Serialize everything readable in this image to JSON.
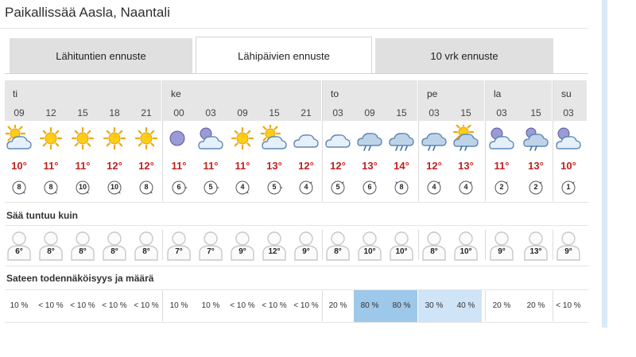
{
  "page": {
    "title": "Paikallissää Aasla, Naantali"
  },
  "tabs": [
    {
      "label": "Lähituntien ennuste",
      "active": false
    },
    {
      "label": "Lähipäivien ennuste",
      "active": true
    },
    {
      "label": "10 vrk ennuste",
      "active": false
    }
  ],
  "days": [
    "ti",
    "ke",
    "to",
    "pe",
    "la",
    "su"
  ],
  "hours": [
    "09",
    "12",
    "15",
    "18",
    "21",
    "00",
    "03",
    "09",
    "15",
    "21",
    "03",
    "09",
    "15",
    "03",
    "15",
    "03",
    "15",
    "03"
  ],
  "day_starts": [
    0,
    5,
    10,
    13,
    15,
    17
  ],
  "icons": [
    "partly-cloudy-icon",
    "sun-icon",
    "sun-icon",
    "sun-icon",
    "sun-icon",
    "moon-icon",
    "cloudy-night-icon",
    "sun-icon",
    "partly-cloudy-icon",
    "cloud-icon",
    "cloud-icon",
    "rain-cloud-icon",
    "heavy-rain-cloud-icon",
    "rain-cloud-icon",
    "sun-rain-icon",
    "cloudy-night-icon",
    "partly-cloudy-rain-icon",
    "cloudy-night-icon"
  ],
  "temps": [
    "10°",
    "11°",
    "11°",
    "12°",
    "12°",
    "11°",
    "11°",
    "11°",
    "13°",
    "12°",
    "12°",
    "13°",
    "14°",
    "12°",
    "13°",
    "11°",
    "13°",
    "10°"
  ],
  "wind_speed": [
    "8",
    "8",
    "10",
    "10",
    "8",
    "6",
    "5",
    "4",
    "5",
    "4",
    "5",
    "6",
    "8",
    "4",
    "4",
    "2",
    "2",
    "1"
  ],
  "wind_dir_deg": [
    135,
    135,
    135,
    135,
    135,
    90,
    90,
    135,
    90,
    45,
    45,
    45,
    315,
    45,
    45,
    45,
    45,
    45
  ],
  "sections": {
    "feels_like": "Sää tuntuu kuin",
    "rain": "Sateen todennäköisyys ja määrä"
  },
  "feels_like": [
    "6°",
    "8°",
    "8°",
    "8°",
    "8°",
    "7°",
    "7°",
    "9°",
    "12°",
    "9°",
    "8°",
    "10°",
    "10°",
    "8°",
    "10°",
    "9°",
    "13°",
    "9°"
  ],
  "rain_prob": [
    "10 %",
    "< 10 %",
    "< 10 %",
    "< 10 %",
    "< 10 %",
    "10 %",
    "10 %",
    "< 10 %",
    "< 10 %",
    "< 10 %",
    "20 %",
    "80 %",
    "80 %",
    "30 %",
    "40 %",
    "20 %",
    "20 %",
    "< 10 %"
  ],
  "colors": {
    "temp": "#c0201f",
    "rain_high": "#9ec8ea",
    "rain_mid": "#cfe4f6",
    "wind_arrow": "#5b6fb5"
  }
}
